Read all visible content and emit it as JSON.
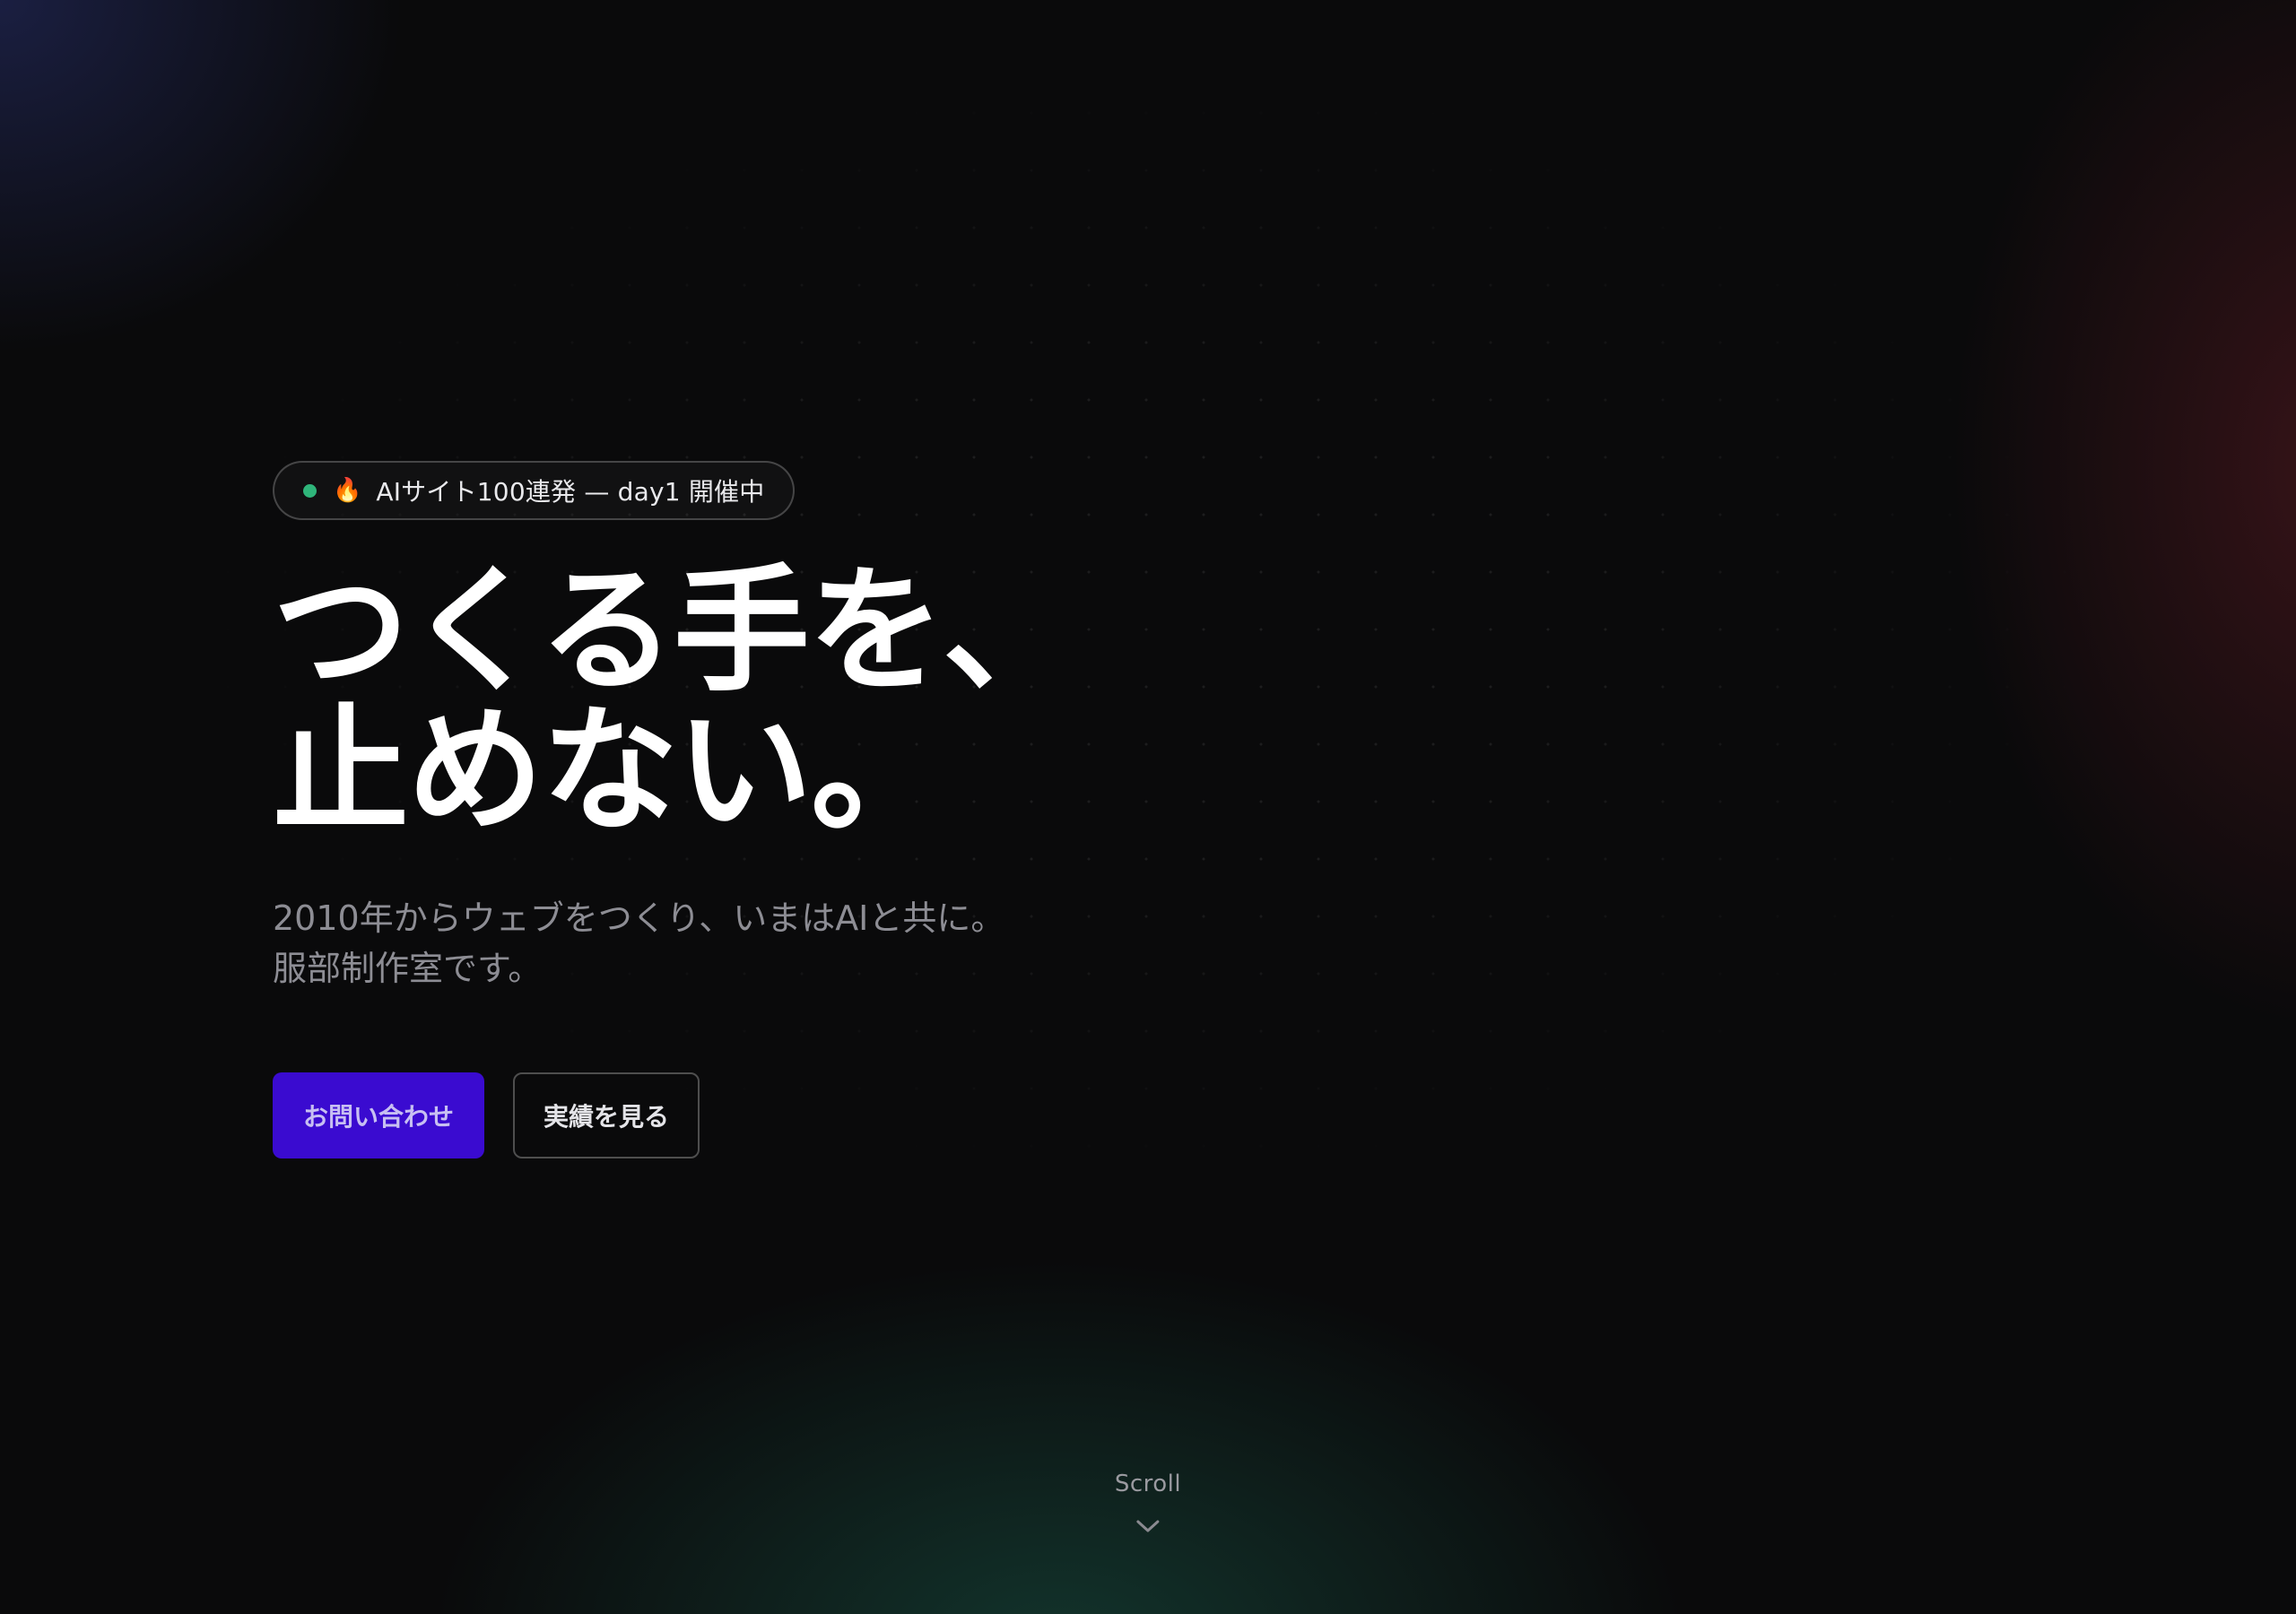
{
  "badge": {
    "text": "AIサイト100連発 — day1 開催中",
    "status_color": "#2fb57a",
    "icon": "fire-icon"
  },
  "hero": {
    "headline_line1": "つくる手を、",
    "headline_line2": "止めない。",
    "subtitle_line1": "2010年からウェブをつくり、いまはAIと共に。",
    "subtitle_line2": "服部制作室です。"
  },
  "buttons": {
    "contact_label": "お問い合わせ",
    "works_label": "実績を見る",
    "primary_color": "#3a0bd0"
  },
  "scroll": {
    "label": "Scroll",
    "icon": "chevron-down-icon"
  }
}
